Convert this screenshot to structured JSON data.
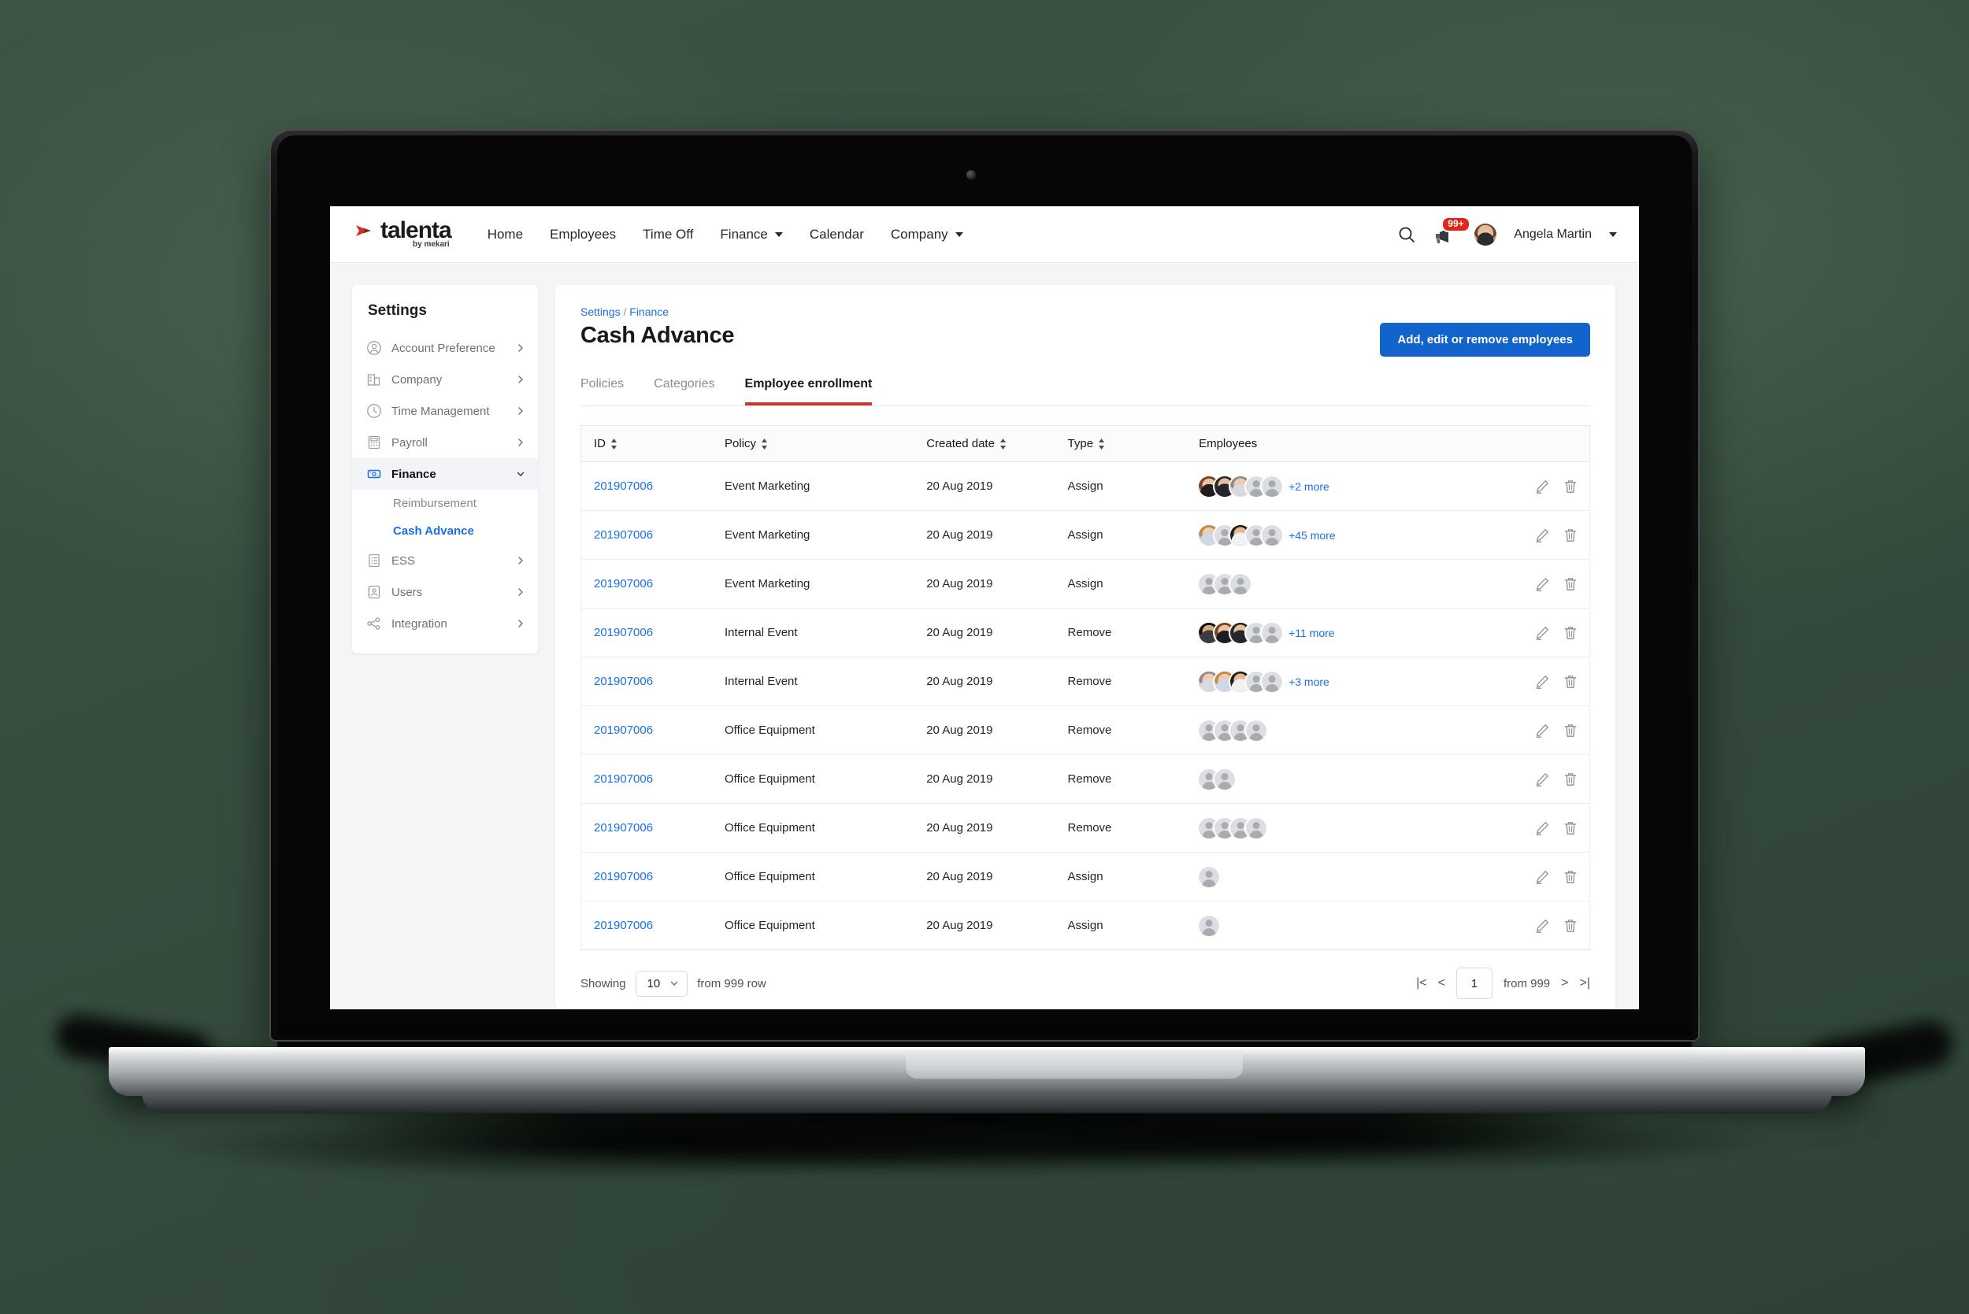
{
  "brand": {
    "name": "talenta",
    "tagline": "by mekari",
    "logo_color": "#d62b20"
  },
  "navbar": {
    "items": [
      {
        "label": "Home",
        "has_caret": false
      },
      {
        "label": "Employees",
        "has_caret": false
      },
      {
        "label": "Time Off",
        "has_caret": false
      },
      {
        "label": "Finance",
        "has_caret": true
      },
      {
        "label": "Calendar",
        "has_caret": false
      },
      {
        "label": "Company",
        "has_caret": true
      }
    ],
    "search_icon": "search-icon",
    "notification_icon": "notification-icon",
    "notification_badge": "99+",
    "user_name": "Angela Martin"
  },
  "sidebar": {
    "title": "Settings",
    "items": [
      {
        "label": "Account Preference",
        "icon": "user-circle-icon",
        "state": "collapsed"
      },
      {
        "label": "Company",
        "icon": "building-icon",
        "state": "collapsed"
      },
      {
        "label": "Time Management",
        "icon": "clock-icon",
        "state": "collapsed"
      },
      {
        "label": "Payroll",
        "icon": "calculator-icon",
        "state": "collapsed"
      },
      {
        "label": "Finance",
        "icon": "money-icon",
        "state": "expanded"
      },
      {
        "label": "ESS",
        "icon": "document-list-icon",
        "state": "collapsed"
      },
      {
        "label": "Users",
        "icon": "id-card-icon",
        "state": "collapsed"
      },
      {
        "label": "Integration",
        "icon": "integration-icon",
        "state": "collapsed"
      }
    ],
    "finance_children": [
      {
        "label": "Reimbursement",
        "current": false
      },
      {
        "label": "Cash Advance",
        "current": true
      }
    ]
  },
  "breadcrumb": {
    "first": "Settings",
    "separator": "/",
    "second": "Finance"
  },
  "header": {
    "title": "Cash Advance",
    "action_button": "Add, edit or remove employees",
    "action_color": "#1264cc"
  },
  "tabs": [
    {
      "label": "Policies",
      "active": false
    },
    {
      "label": "Categories",
      "active": false
    },
    {
      "label": "Employee enrollment",
      "active": true
    }
  ],
  "tab_accent": "#d0342c",
  "table": {
    "columns": [
      {
        "label": "ID",
        "sortable": true
      },
      {
        "label": "Policy",
        "sortable": true
      },
      {
        "label": "Created date",
        "sortable": true
      },
      {
        "label": "Type",
        "sortable": true
      },
      {
        "label": "Employees",
        "sortable": false
      },
      {
        "label": "",
        "sortable": false
      }
    ],
    "rows": [
      {
        "id": "201907006",
        "policy": "Event Marketing",
        "created": "20 Aug 2019",
        "type": "Assign",
        "photos": 3,
        "placeholders": 2,
        "more": "+2 more"
      },
      {
        "id": "201907006",
        "policy": "Event Marketing",
        "created": "20 Aug 2019",
        "type": "Assign",
        "photos": 1,
        "placeholders": 1,
        "photos2": 1,
        "placeholders2": 2,
        "more": "+45 more"
      },
      {
        "id": "201907006",
        "policy": "Event Marketing",
        "created": "20 Aug 2019",
        "type": "Assign",
        "photos": 0,
        "placeholders": 3,
        "more": ""
      },
      {
        "id": "201907006",
        "policy": "Internal Event",
        "created": "20 Aug 2019",
        "type": "Remove",
        "photos": 3,
        "placeholders": 2,
        "more": "+11 more"
      },
      {
        "id": "201907006",
        "policy": "Internal Event",
        "created": "20 Aug 2019",
        "type": "Remove",
        "photos": 3,
        "placeholders": 2,
        "more": "+3 more"
      },
      {
        "id": "201907006",
        "policy": "Office Equipment",
        "created": "20 Aug 2019",
        "type": "Remove",
        "photos": 0,
        "placeholders": 4,
        "more": ""
      },
      {
        "id": "201907006",
        "policy": "Office Equipment",
        "created": "20 Aug 2019",
        "type": "Remove",
        "photos": 0,
        "placeholders": 2,
        "more": ""
      },
      {
        "id": "201907006",
        "policy": "Office Equipment",
        "created": "20 Aug 2019",
        "type": "Remove",
        "photos": 0,
        "placeholders": 4,
        "more": ""
      },
      {
        "id": "201907006",
        "policy": "Office Equipment",
        "created": "20 Aug 2019",
        "type": "Assign",
        "photos": 0,
        "placeholders": 1,
        "more": ""
      },
      {
        "id": "201907006",
        "policy": "Office Equipment",
        "created": "20 Aug 2019",
        "type": "Assign",
        "photos": 0,
        "placeholders": 1,
        "more": ""
      }
    ],
    "row_actions": [
      "edit-icon",
      "delete-icon"
    ]
  },
  "footer": {
    "showing_label": "Showing",
    "page_size": "10",
    "rows_label": "from 999 row",
    "page_value": "1",
    "page_total_label": "from 999",
    "first_icon": "first-page-icon",
    "prev_icon": "prev-page-icon",
    "next_icon": "next-page-icon",
    "last_icon": "last-page-icon"
  }
}
